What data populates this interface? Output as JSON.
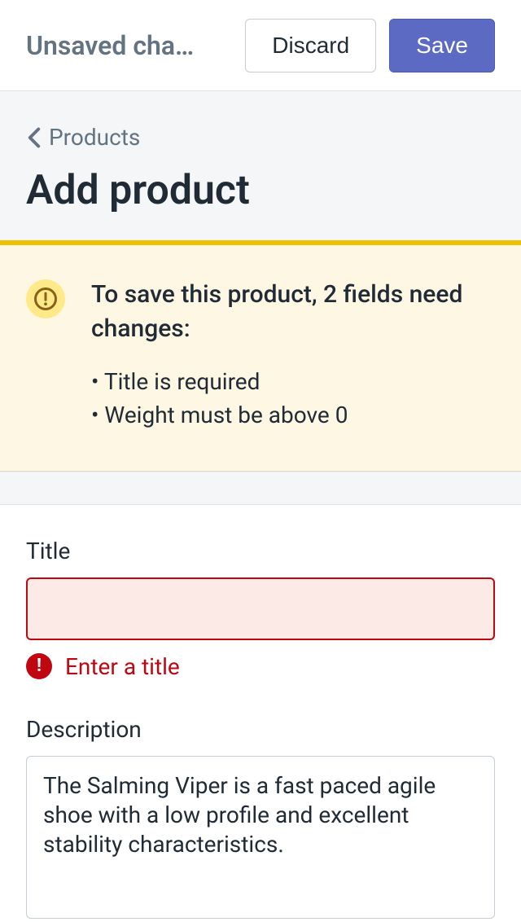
{
  "topbar": {
    "status": "Unsaved cha…",
    "discard": "Discard",
    "save": "Save"
  },
  "breadcrumb": {
    "label": "Products"
  },
  "page": {
    "title": "Add product"
  },
  "banner": {
    "heading": "To save this product, 2 fields need changes:",
    "items": [
      "Title is required",
      "Weight must be above 0"
    ]
  },
  "form": {
    "title": {
      "label": "Title",
      "value": "",
      "error": "Enter a title"
    },
    "description": {
      "label": "Description",
      "value": "The Salming Viper is a fast paced agile shoe with a low profile and excellent stability characteristics."
    }
  }
}
